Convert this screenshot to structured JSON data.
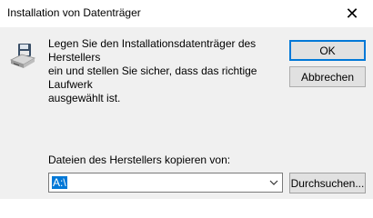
{
  "window": {
    "title": "Installation von Datenträger",
    "close_glyph": "✕"
  },
  "dialog": {
    "icon": "floppy-disk-drive-icon",
    "message": "Legen Sie den Installationsdatenträger des Herstellers\nein und stellen Sie sicher, dass das richtige Laufwerk\nausgewählt ist.",
    "ok_label": "OK",
    "cancel_label": "Abbrechen",
    "copy_from_label": "Dateien des Herstellers kopieren von:",
    "path_value": "A:\\",
    "browse_label": "Durchsuchen..."
  },
  "colors": {
    "accent": "#0078d7",
    "client_bg": "#f0f0f0",
    "button_bg": "#e1e1e1"
  }
}
